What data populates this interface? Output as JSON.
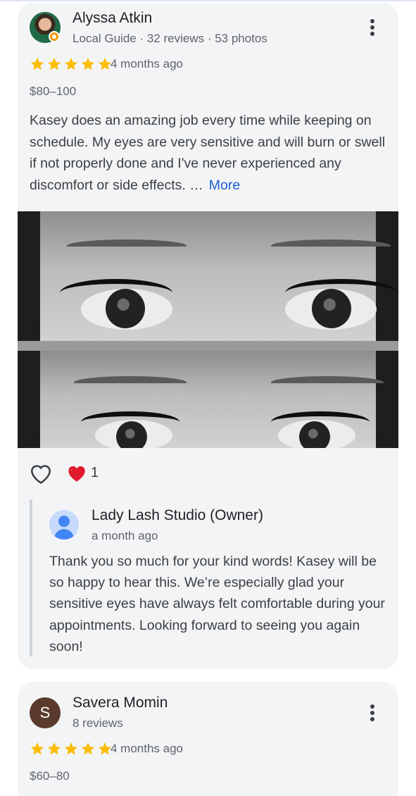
{
  "reviews": [
    {
      "author": "Alyssa Atkin",
      "meta": "Local Guide · 32 reviews · 53 photos",
      "rating": 5,
      "time": "4 months ago",
      "price": "$80–100",
      "text": "Kasey does an amazing job every time while keeping on schedule. My eyes are very sensitive and will burn or swell if not properly done and I've never experienced any discomfort or side effects. …",
      "more_label": "More",
      "reaction_count": "1",
      "owner_reply": {
        "name": "Lady Lash Studio (Owner)",
        "time": "a month ago",
        "text": "Thank you so much for your kind words! Kasey will be so happy to hear this. We’re especially glad your sensitive eyes have always felt comfortable during your appointments. Looking forward to seeing you again soon!"
      }
    },
    {
      "author": "Savera Momin",
      "avatar_letter": "S",
      "meta": "8 reviews",
      "rating": 5,
      "time": "4 months ago",
      "price": "$60–80"
    }
  ],
  "colors": {
    "star": "#fbbc04",
    "link": "#1a5fd0",
    "heart": "#e0192b",
    "card_bg": "#f3f4f6"
  },
  "icons": {
    "menu": "more-vert-icon",
    "like": "heart-outline-icon",
    "reaction": "red-heart-emoji-icon",
    "owner": "person-avatar-icon"
  }
}
